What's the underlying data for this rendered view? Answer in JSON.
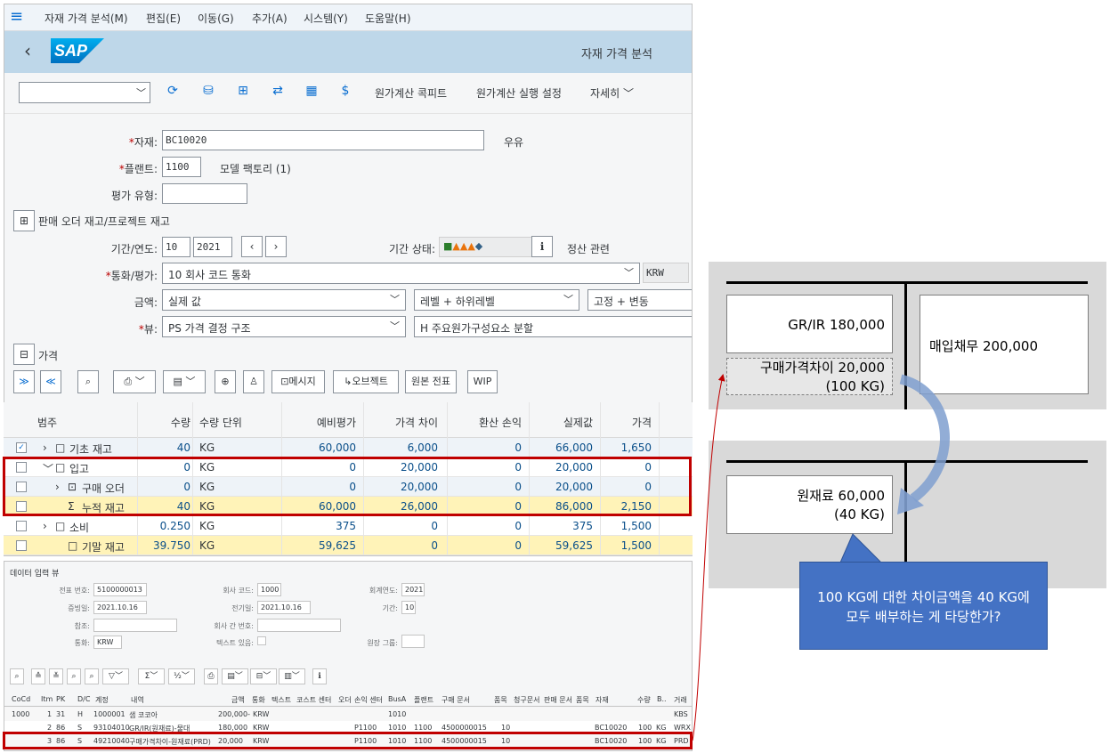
{
  "menu": [
    "자재 가격 분석(M)",
    "편집(E)",
    "이동(G)",
    "추가(A)",
    "시스템(Y)",
    "도움말(H)"
  ],
  "shell_title": "자재 가격 분석",
  "logo": "SAP",
  "toolbar": {
    "btn1": "원가계산 콕피트",
    "btn2": "원가계산 실행 설정",
    "more": "자세히"
  },
  "form": {
    "material_label": "자재:",
    "material_value": "BC10020",
    "material_desc": "우유",
    "plant_label": "플랜트:",
    "plant_value": "1100",
    "plant_desc": "모델 팩토리 (1)",
    "valtype_label": "평가 유형:",
    "sales_order": "판매 오더 재고/프로젝트 재고",
    "period_label": "기간/연도:",
    "period_value": "10",
    "year_value": "2021",
    "period_status_label": "기간 상태:",
    "settlement": "정산 관련",
    "currency_label": "통화/평가:",
    "currency_value": "10 회사 코드 통화",
    "currency_code": "KRW",
    "amount_label": "금액:",
    "amount_value": "실제 값",
    "level_value": "레벨 + 하위레벨",
    "fixvar_value": "고정 + 변동",
    "view_label": "뷰:",
    "view_value": "PS 가격 결정 구조",
    "view2_value": "H 주요원가구성요소 분할",
    "price_section": "가격"
  },
  "grid_toolbar": {
    "msg": "메시지",
    "obj": "오브젝트",
    "orig": "원본 전표",
    "wip": "WIP"
  },
  "grid": {
    "headers": [
      "범주",
      "수량",
      "수량 단위",
      "예비평가",
      "가격 차이",
      "환산 손익",
      "실제값",
      "가격"
    ],
    "rows": [
      {
        "cat": "기초 재고",
        "qty": "40",
        "unit": "KG",
        "prelim": "60,000",
        "pdiff": "6,000",
        "fx": "0",
        "actual": "66,000",
        "price": "1,650"
      },
      {
        "cat": "입고",
        "qty": "0",
        "unit": "KG",
        "prelim": "0",
        "pdiff": "20,000",
        "fx": "0",
        "actual": "20,000",
        "price": "0"
      },
      {
        "cat": "구매 오더",
        "qty": "0",
        "unit": "KG",
        "prelim": "0",
        "pdiff": "20,000",
        "fx": "0",
        "actual": "20,000",
        "price": "0"
      },
      {
        "cat": "누적 재고",
        "qty": "40",
        "unit": "KG",
        "prelim": "60,000",
        "pdiff": "26,000",
        "fx": "0",
        "actual": "86,000",
        "price": "2,150"
      },
      {
        "cat": "소비",
        "qty": "0.250",
        "unit": "KG",
        "prelim": "375",
        "pdiff": "0",
        "fx": "0",
        "actual": "375",
        "price": "1,500"
      },
      {
        "cat": "기말 재고",
        "qty": "39.750",
        "unit": "KG",
        "prelim": "59,625",
        "pdiff": "0",
        "fx": "0",
        "actual": "59,625",
        "price": "1,500"
      }
    ]
  },
  "lower": {
    "title": "데이터 입력 뷰",
    "doc_no_label": "전표 번호:",
    "doc_no": "5100000013",
    "company_label": "회사 코드:",
    "company": "1000",
    "fy_label": "회계연도:",
    "fy": "2021",
    "docdate_label": "증빙일:",
    "docdate": "2021.10.16",
    "postdate_label": "전기일:",
    "postdate": "2021.10.16",
    "period_label": "기간:",
    "period": "10",
    "ref_label": "참조:",
    "intercompany_label": "회사 간 번호:",
    "currency_label": "통화:",
    "currency": "KRW",
    "text_label": "텍스트 있음:",
    "ledger_label": "원장 그룹:",
    "columns": [
      "CoCd",
      "Itm",
      "PK",
      "D/C",
      "계정",
      "내역",
      "금액",
      "통화",
      "텍스트",
      "코스트 센터",
      "오더",
      "손익 센터",
      "BusA",
      "플랜트",
      "구매 문서",
      "품목",
      "청구문서",
      "판매 문서",
      "품목",
      "자재",
      "수량",
      "B..",
      "거래"
    ],
    "rows": [
      {
        "cocd": "1000",
        "itm": "1",
        "pk": "31",
        "dc": "H",
        "acct": "1000001",
        "desc": "샘 코코아",
        "amt": "200,000-",
        "cur": "KRW",
        "pc": "",
        "busa": "1010",
        "plant": "",
        "po": "",
        "item": "",
        "mat": "",
        "qty": "",
        "bun": "",
        "tr": "KBS"
      },
      {
        "cocd": "",
        "itm": "2",
        "pk": "86",
        "dc": "S",
        "acct": "93104010",
        "desc": "GR/IR(원재료)-물대",
        "amt": "180,000",
        "cur": "KRW",
        "pc": "P1100",
        "busa": "1010",
        "plant": "1100",
        "po": "4500000015",
        "item": "10",
        "mat": "BC10020",
        "qty": "100",
        "bun": "KG",
        "tr": "WRX"
      },
      {
        "cocd": "",
        "itm": "3",
        "pk": "86",
        "dc": "S",
        "acct": "49210040",
        "desc": "구매가격차이-원재료(PRD)",
        "amt": "20,000",
        "cur": "KRW",
        "pc": "P1100",
        "busa": "1010",
        "plant": "1100",
        "po": "4500000015",
        "item": "10",
        "mat": "BC10020",
        "qty": "100",
        "bun": "KG",
        "tr": "PRD"
      }
    ]
  },
  "diagram": {
    "grir": "GR/IR 180,000",
    "ap": "매입채무 200,000",
    "ppv_line1": "구매가격차이 20,000",
    "ppv_line2": "(100 KG)",
    "raw_line1": "원재료 60,000",
    "raw_line2": "(40 KG)",
    "callout": "100 KG에 대한 차이금액을 40 KG에 모두 배부하는 게 타당한가?"
  },
  "colors": {
    "accent": "#0a6ed1",
    "highlight": "#fff3b8",
    "red": "#c00000",
    "callout": "#4472c4"
  }
}
